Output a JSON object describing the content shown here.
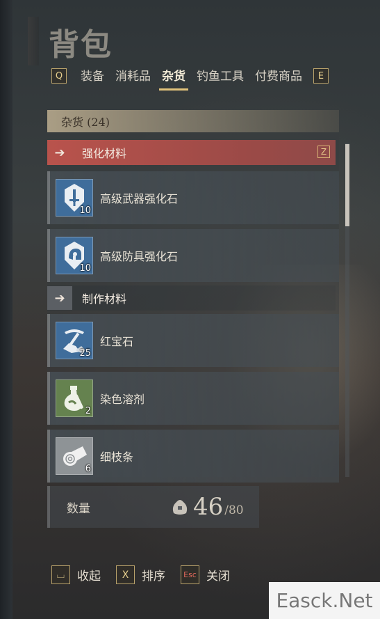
{
  "title": "背包",
  "tabs": {
    "left_key": "Q",
    "right_key": "E",
    "items": [
      {
        "label": "装备",
        "active": false
      },
      {
        "label": "消耗品",
        "active": false
      },
      {
        "label": "杂货",
        "active": true
      },
      {
        "label": "钓鱼工具",
        "active": false
      },
      {
        "label": "付费商品",
        "active": false
      }
    ]
  },
  "category": {
    "label": "杂货 (24)"
  },
  "sections": [
    {
      "label": "强化材料",
      "key": "Z",
      "active": true,
      "items": [
        {
          "name": "高级武器强化石",
          "count": "10",
          "icon": "sword-stone-icon",
          "color": "#3f6d9b"
        },
        {
          "name": "高级防具强化石",
          "count": "10",
          "icon": "helmet-stone-icon",
          "color": "#3f6d9b"
        }
      ]
    },
    {
      "label": "制作材料",
      "active": false,
      "items": [
        {
          "name": "红宝石",
          "count": "25",
          "icon": "pickaxe-ore-icon",
          "color": "#3f6d9b"
        },
        {
          "name": "染色溶剂",
          "count": "2",
          "icon": "flask-icon",
          "color": "#65824f"
        },
        {
          "name": "细枝条",
          "count": "6",
          "icon": "log-icon",
          "color": "#8e9396"
        }
      ]
    }
  ],
  "capacity": {
    "label": "数量",
    "current": "46",
    "max": "/80"
  },
  "footer": [
    {
      "key": "⌴",
      "label": "收起"
    },
    {
      "key": "X",
      "label": "排序"
    },
    {
      "key": "Esc",
      "label": "关闭"
    }
  ],
  "watermark": "Easck.Net",
  "colors": {
    "accent": "#e2c37b",
    "active_section": "#b9534c"
  }
}
